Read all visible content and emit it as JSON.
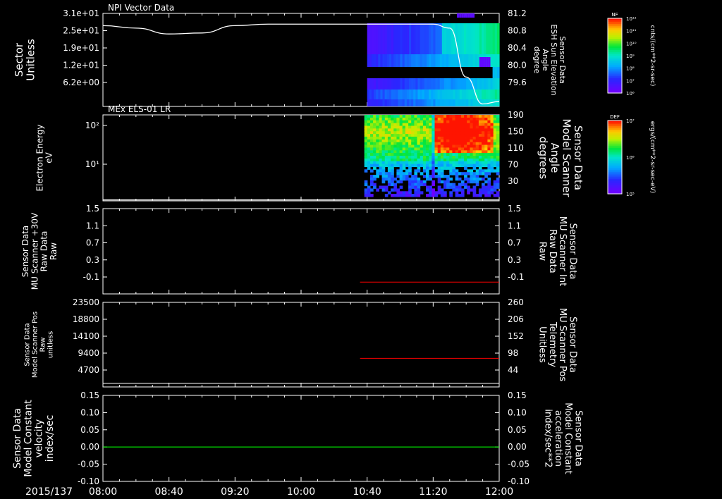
{
  "footer": {
    "date": "2015/137"
  },
  "time_axis": {
    "labels": [
      "08:00",
      "08:40",
      "09:20",
      "10:00",
      "10:40",
      "11:20",
      "12:00"
    ]
  },
  "colors": {
    "red_line": "#ff0000",
    "green_line": "#00ff00",
    "white_line": "#ffffff"
  },
  "panels": [
    {
      "id": "p1",
      "title": "NPI Vector Data",
      "ylabel": [
        "Sector",
        "Unitless"
      ],
      "yticks": [
        "3.1e+01",
        "2.5e+01",
        "1.9e+01",
        "1.2e+01",
        "6.2e+00"
      ],
      "rlabel": [
        "Sensor Data",
        "ESH Sun Elevation",
        "Angle",
        "degree"
      ],
      "rticks": [
        "81.2",
        "80.8",
        "80.4",
        "80.0",
        "79.6"
      ],
      "colorbar": {
        "tag": "NF",
        "unit": "cnts/(cm**2-sr-sec)",
        "ticks": [
          "10¹²",
          "10¹¹",
          "10¹⁰",
          "10⁹",
          "10⁸",
          "10⁷",
          "10⁶"
        ]
      }
    },
    {
      "id": "p2",
      "title": "MEx ELS-01 LR",
      "ylabel": [
        "Electron Energy",
        "eV"
      ],
      "yticks": [
        "10²",
        "10¹"
      ],
      "rlabel": [
        "Sensor Data",
        "Model Scanner",
        "Angle",
        "degrees"
      ],
      "rticks": [
        "190",
        "150",
        "110",
        "70",
        "30"
      ],
      "colorbar": {
        "tag": "DEF",
        "unit": "ergs/(cm**2-sr-sec-eV)",
        "ticks": [
          "10⁷",
          "10⁶",
          "10⁵"
        ]
      }
    },
    {
      "id": "p3",
      "title": "",
      "ylabel": [
        "Sensor Data",
        "MU Scanner +30V",
        "Raw Data",
        "Raw"
      ],
      "yticks": [
        "1.5",
        "1.1",
        "0.7",
        "0.3",
        "-0.1"
      ],
      "rlabel": [
        "Sensor Data",
        "MU Scanner Int",
        "Raw Data",
        "Raw"
      ],
      "rticks": [
        "1.5",
        "1.1",
        "0.7",
        "0.3",
        "-0.1"
      ]
    },
    {
      "id": "p4",
      "title": "",
      "ylabel": [
        "Sensor Data",
        "Model Scanner Pos",
        "Raw",
        "unitless"
      ],
      "yticks": [
        "23500",
        "18800",
        "14100",
        "9400",
        "4700"
      ],
      "rlabel": [
        "Sensor Data",
        "MU Scanner Pos",
        "Telemetry",
        "Unitless"
      ],
      "rticks": [
        "260",
        "206",
        "152",
        "98",
        "44"
      ]
    },
    {
      "id": "p5",
      "title": "",
      "ylabel": [
        "Sensor Data",
        "Model Constant",
        "velocity",
        "index/sec"
      ],
      "yticks": [
        "0.15",
        "0.10",
        "0.05",
        "0.00",
        "-0.05",
        "-0.10"
      ],
      "rlabel": [
        "Sensor Data",
        "Model Constant",
        "acceleration",
        "index/sec**2"
      ],
      "rticks": [
        "0.15",
        "0.10",
        "0.05",
        "0.00",
        "-0.05",
        "-0.10"
      ]
    }
  ],
  "chart_data": [
    {
      "type": "heatmap",
      "panel": "p1",
      "title": "NPI Vector Data",
      "ylabel": "Sector Unitless",
      "y2label": "Sensor Data ESH Sun Elevation Angle degree",
      "x_range": [
        "08:00",
        "12:00"
      ],
      "data_start": "10:40",
      "y2lim": [
        79.3,
        81.2
      ],
      "series": [
        {
          "axis": "y2",
          "x": [
            "08:00",
            "08:20",
            "08:40",
            "09:00",
            "09:20",
            "09:40",
            "10:00",
            "10:40",
            "11:20",
            "11:30",
            "11:40",
            "11:50",
            "12:00"
          ],
          "values": [
            80.95,
            80.9,
            80.78,
            80.8,
            80.95,
            80.98,
            80.98,
            80.98,
            80.98,
            80.9,
            79.9,
            79.35,
            79.4
          ]
        }
      ]
    },
    {
      "type": "heatmap",
      "panel": "p2",
      "title": "MEx ELS-01 LR",
      "ylabel": "Electron Energy eV",
      "y2label": "Sensor Data Model Scanner Angle degrees",
      "x_range": [
        "08:00",
        "12:00"
      ],
      "data_start": "10:40",
      "yscale": "log",
      "y2lim": [
        10,
        190
      ],
      "series": [
        {
          "axis": "y2",
          "x": [
            "08:00",
            "12:00"
          ],
          "values": [
            12,
            12
          ]
        }
      ]
    },
    {
      "type": "line",
      "panel": "p3",
      "ylim": [
        -0.3,
        1.5
      ],
      "series": [
        {
          "axis": "y2",
          "x": [
            "10:40",
            "12:00"
          ],
          "values": [
            -0.05,
            -0.05
          ]
        }
      ]
    },
    {
      "type": "line",
      "panel": "p4",
      "ylim": [
        0,
        23500
      ],
      "y2lim": [
        0,
        260
      ],
      "series": [
        {
          "axis": "y2",
          "x": [
            "10:40",
            "12:00"
          ],
          "values": [
            88,
            88
          ]
        }
      ]
    },
    {
      "type": "line",
      "panel": "p5",
      "ylim": [
        -0.1,
        0.15
      ],
      "series": [
        {
          "axis": "y",
          "x": [
            "08:00",
            "12:00"
          ],
          "values": [
            0.0,
            0.0
          ]
        }
      ]
    }
  ]
}
